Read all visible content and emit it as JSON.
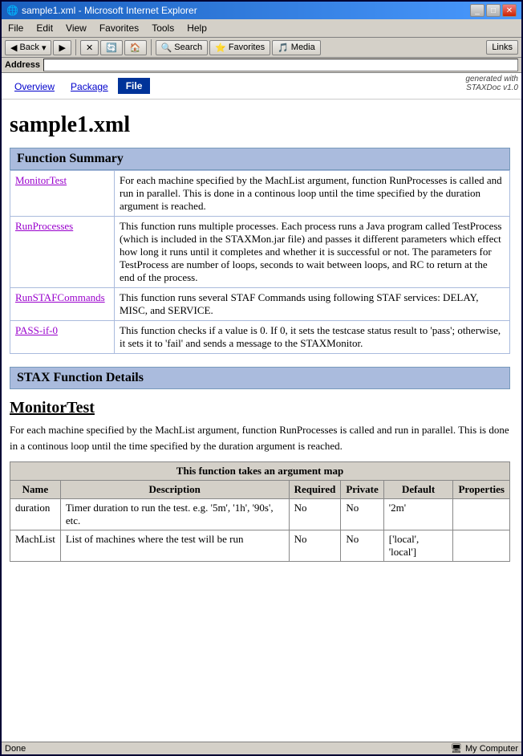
{
  "window": {
    "title": "sample1.xml - Microsoft Internet Explorer",
    "icon": "🌐"
  },
  "menu": {
    "items": [
      "File",
      "Edit",
      "View",
      "Favorites",
      "Tools",
      "Help"
    ]
  },
  "toolbar": {
    "back_label": "Back",
    "refresh_label": "🔄",
    "stop_label": "✕",
    "search_label": "Search",
    "favorites_label": "Favorites",
    "media_label": "Media",
    "address_label": "Address",
    "links_label": "Links"
  },
  "nav": {
    "tabs": [
      "Overview",
      "Package",
      "File"
    ],
    "active_tab": "File",
    "generated_line1": "generated with",
    "generated_line2": "STAXDoc v1.0"
  },
  "page": {
    "title": "sample1.xml",
    "function_summary_header": "Function Summary",
    "function_details_header": "STAX Function Details",
    "functions": [
      {
        "name": "MonitorTest",
        "description": "For each machine specified by the MachList argument, function RunProcesses is called and run in parallel. This is done in a continous loop until the time specified by the duration argument is reached."
      },
      {
        "name": "RunProcesses",
        "description": "This function runs multiple processes. Each process runs a Java program called TestProcess (which is included in the STAXMon.jar file) and passes it different parameters which effect how long it runs until it completes and whether it is successful or not. The parameters for TestProcess are number of loops, seconds to wait between loops, and RC to return at the end of the process."
      },
      {
        "name": "RunSTAFCommands",
        "description": "This function runs several STAF Commands using following STAF services: DELAY, MISC, and SERVICE."
      },
      {
        "name": "PASS-if-0",
        "description": "This function checks if a value is 0. If 0, it sets the testcase status result to 'pass'; otherwise, it sets it to 'fail' and sends a message to the STAXMonitor."
      }
    ],
    "monitor_test": {
      "title": "MonitorTest",
      "description": "For each machine specified by the MachList argument, function RunProcesses is called and run in parallel. This is done in a continous loop until the time specified by the duration argument is reached.",
      "arg_map_title": "This function takes an argument map",
      "table_headers": [
        "Name",
        "Description",
        "Required",
        "Private",
        "Default",
        "Properties"
      ],
      "args": [
        {
          "name": "duration",
          "description": "Timer duration to run the test. e.g. '5m', '1h', '90s', etc.",
          "required": "No",
          "private": "No",
          "default": "'2m'",
          "properties": ""
        },
        {
          "name": "MachList",
          "description": "List of machines where the test will be run",
          "required": "No",
          "private": "No",
          "default": "['local', 'local']",
          "properties": ""
        }
      ]
    }
  },
  "status_bar": {
    "left": "Done",
    "right": "My Computer"
  }
}
